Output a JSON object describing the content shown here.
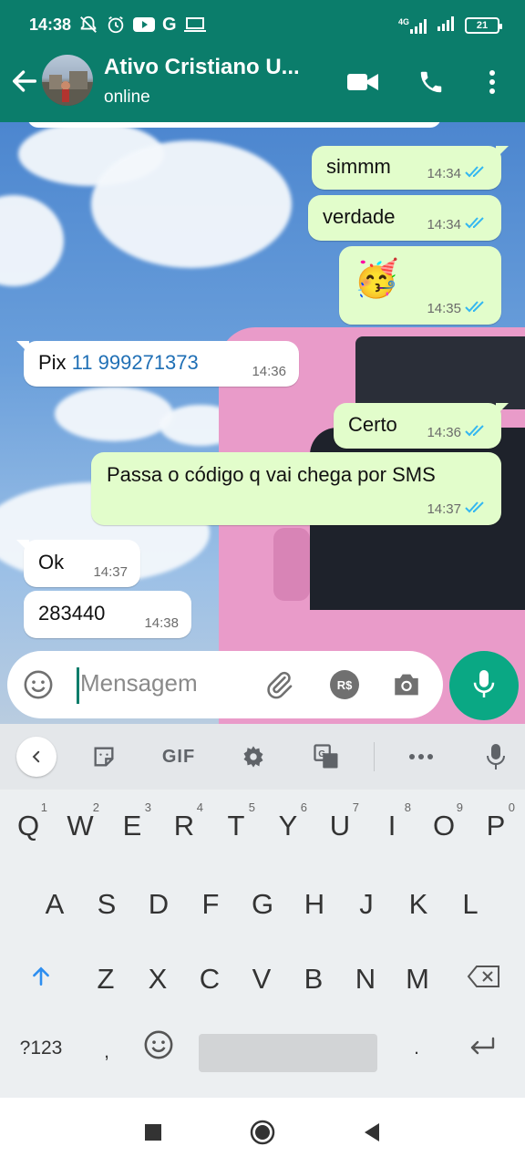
{
  "status_bar": {
    "time": "14:38",
    "network": "4G",
    "battery": "21",
    "icons": [
      "notifications-off-icon",
      "alarm-icon",
      "youtube-icon",
      "google-icon",
      "laptop-icon",
      "signal-icon",
      "signal-icon",
      "battery-icon"
    ]
  },
  "header": {
    "contact_name": "Ativo Cristiano U...",
    "status": "online",
    "icons": [
      "back-arrow-icon",
      "video-call-icon",
      "voice-call-icon",
      "more-vert-icon"
    ]
  },
  "messages": [
    {
      "direction": "out",
      "text": "simmm",
      "time": "14:34",
      "read": true
    },
    {
      "direction": "out",
      "text": "verdade",
      "time": "14:34",
      "read": true
    },
    {
      "direction": "out",
      "text": "🥳",
      "time": "14:35",
      "read": true
    },
    {
      "direction": "in",
      "text_prefix": "Pix ",
      "link": "11 999271373",
      "time": "14:36"
    },
    {
      "direction": "out",
      "text": "Certo",
      "time": "14:36",
      "read": true
    },
    {
      "direction": "out",
      "text": "Passa o código q vai chega por SMS",
      "time": "14:37",
      "read": true
    },
    {
      "direction": "in",
      "text": "Ok",
      "time": "14:37"
    },
    {
      "direction": "in",
      "text": "283440",
      "time": "14:38"
    }
  ],
  "composer": {
    "placeholder": "Mensagem",
    "payment_label": "R$",
    "icons": [
      "emoji-icon",
      "attach-icon",
      "payment-icon",
      "camera-icon",
      "mic-icon"
    ]
  },
  "keyboard": {
    "toolbar": {
      "gif_label": "GIF",
      "icons": [
        "chevron-left-icon",
        "sticker-icon",
        "gif-icon",
        "settings-icon",
        "translate-icon",
        "more-horiz-icon",
        "mic-icon"
      ]
    },
    "row1": [
      {
        "k": "Q",
        "n": "1"
      },
      {
        "k": "W",
        "n": "2"
      },
      {
        "k": "E",
        "n": "3"
      },
      {
        "k": "R",
        "n": "4"
      },
      {
        "k": "T",
        "n": "5"
      },
      {
        "k": "Y",
        "n": "6"
      },
      {
        "k": "U",
        "n": "7"
      },
      {
        "k": "I",
        "n": "8"
      },
      {
        "k": "O",
        "n": "9"
      },
      {
        "k": "P",
        "n": "0"
      }
    ],
    "row2": [
      "A",
      "S",
      "D",
      "F",
      "G",
      "H",
      "J",
      "K",
      "L"
    ],
    "row3": [
      "Z",
      "X",
      "C",
      "V",
      "B",
      "N",
      "M"
    ],
    "row4": {
      "symbols": "?123",
      "comma": ",",
      "period": "."
    }
  },
  "colors": {
    "header": "#0b7d6b",
    "outgoing_bubble": "#e2fdcb",
    "incoming_bubble": "#ffffff",
    "read_ticks": "#34b7f1",
    "mic_button": "#0aa884",
    "link": "#1f6fb5"
  }
}
